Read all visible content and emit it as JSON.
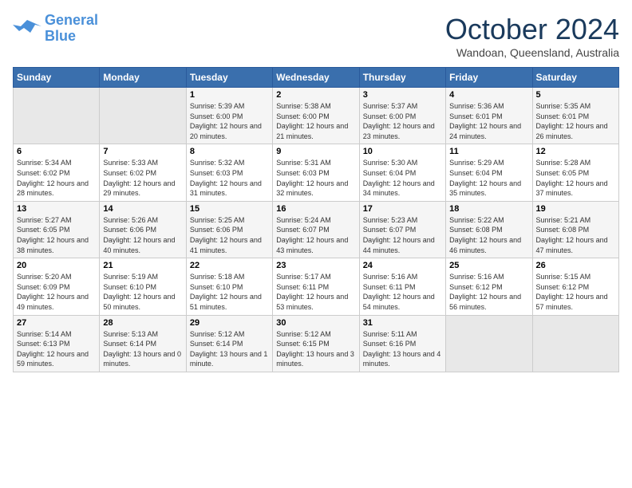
{
  "logo": {
    "line1": "General",
    "line2": "Blue"
  },
  "title": "October 2024",
  "location": "Wandoan, Queensland, Australia",
  "headers": [
    "Sunday",
    "Monday",
    "Tuesday",
    "Wednesday",
    "Thursday",
    "Friday",
    "Saturday"
  ],
  "weeks": [
    [
      {
        "day": "",
        "sunrise": "",
        "sunset": "",
        "daylight": ""
      },
      {
        "day": "",
        "sunrise": "",
        "sunset": "",
        "daylight": ""
      },
      {
        "day": "1",
        "sunrise": "Sunrise: 5:39 AM",
        "sunset": "Sunset: 6:00 PM",
        "daylight": "Daylight: 12 hours and 20 minutes."
      },
      {
        "day": "2",
        "sunrise": "Sunrise: 5:38 AM",
        "sunset": "Sunset: 6:00 PM",
        "daylight": "Daylight: 12 hours and 21 minutes."
      },
      {
        "day": "3",
        "sunrise": "Sunrise: 5:37 AM",
        "sunset": "Sunset: 6:00 PM",
        "daylight": "Daylight: 12 hours and 23 minutes."
      },
      {
        "day": "4",
        "sunrise": "Sunrise: 5:36 AM",
        "sunset": "Sunset: 6:01 PM",
        "daylight": "Daylight: 12 hours and 24 minutes."
      },
      {
        "day": "5",
        "sunrise": "Sunrise: 5:35 AM",
        "sunset": "Sunset: 6:01 PM",
        "daylight": "Daylight: 12 hours and 26 minutes."
      }
    ],
    [
      {
        "day": "6",
        "sunrise": "Sunrise: 5:34 AM",
        "sunset": "Sunset: 6:02 PM",
        "daylight": "Daylight: 12 hours and 28 minutes."
      },
      {
        "day": "7",
        "sunrise": "Sunrise: 5:33 AM",
        "sunset": "Sunset: 6:02 PM",
        "daylight": "Daylight: 12 hours and 29 minutes."
      },
      {
        "day": "8",
        "sunrise": "Sunrise: 5:32 AM",
        "sunset": "Sunset: 6:03 PM",
        "daylight": "Daylight: 12 hours and 31 minutes."
      },
      {
        "day": "9",
        "sunrise": "Sunrise: 5:31 AM",
        "sunset": "Sunset: 6:03 PM",
        "daylight": "Daylight: 12 hours and 32 minutes."
      },
      {
        "day": "10",
        "sunrise": "Sunrise: 5:30 AM",
        "sunset": "Sunset: 6:04 PM",
        "daylight": "Daylight: 12 hours and 34 minutes."
      },
      {
        "day": "11",
        "sunrise": "Sunrise: 5:29 AM",
        "sunset": "Sunset: 6:04 PM",
        "daylight": "Daylight: 12 hours and 35 minutes."
      },
      {
        "day": "12",
        "sunrise": "Sunrise: 5:28 AM",
        "sunset": "Sunset: 6:05 PM",
        "daylight": "Daylight: 12 hours and 37 minutes."
      }
    ],
    [
      {
        "day": "13",
        "sunrise": "Sunrise: 5:27 AM",
        "sunset": "Sunset: 6:05 PM",
        "daylight": "Daylight: 12 hours and 38 minutes."
      },
      {
        "day": "14",
        "sunrise": "Sunrise: 5:26 AM",
        "sunset": "Sunset: 6:06 PM",
        "daylight": "Daylight: 12 hours and 40 minutes."
      },
      {
        "day": "15",
        "sunrise": "Sunrise: 5:25 AM",
        "sunset": "Sunset: 6:06 PM",
        "daylight": "Daylight: 12 hours and 41 minutes."
      },
      {
        "day": "16",
        "sunrise": "Sunrise: 5:24 AM",
        "sunset": "Sunset: 6:07 PM",
        "daylight": "Daylight: 12 hours and 43 minutes."
      },
      {
        "day": "17",
        "sunrise": "Sunrise: 5:23 AM",
        "sunset": "Sunset: 6:07 PM",
        "daylight": "Daylight: 12 hours and 44 minutes."
      },
      {
        "day": "18",
        "sunrise": "Sunrise: 5:22 AM",
        "sunset": "Sunset: 6:08 PM",
        "daylight": "Daylight: 12 hours and 46 minutes."
      },
      {
        "day": "19",
        "sunrise": "Sunrise: 5:21 AM",
        "sunset": "Sunset: 6:08 PM",
        "daylight": "Daylight: 12 hours and 47 minutes."
      }
    ],
    [
      {
        "day": "20",
        "sunrise": "Sunrise: 5:20 AM",
        "sunset": "Sunset: 6:09 PM",
        "daylight": "Daylight: 12 hours and 49 minutes."
      },
      {
        "day": "21",
        "sunrise": "Sunrise: 5:19 AM",
        "sunset": "Sunset: 6:10 PM",
        "daylight": "Daylight: 12 hours and 50 minutes."
      },
      {
        "day": "22",
        "sunrise": "Sunrise: 5:18 AM",
        "sunset": "Sunset: 6:10 PM",
        "daylight": "Daylight: 12 hours and 51 minutes."
      },
      {
        "day": "23",
        "sunrise": "Sunrise: 5:17 AM",
        "sunset": "Sunset: 6:11 PM",
        "daylight": "Daylight: 12 hours and 53 minutes."
      },
      {
        "day": "24",
        "sunrise": "Sunrise: 5:16 AM",
        "sunset": "Sunset: 6:11 PM",
        "daylight": "Daylight: 12 hours and 54 minutes."
      },
      {
        "day": "25",
        "sunrise": "Sunrise: 5:16 AM",
        "sunset": "Sunset: 6:12 PM",
        "daylight": "Daylight: 12 hours and 56 minutes."
      },
      {
        "day": "26",
        "sunrise": "Sunrise: 5:15 AM",
        "sunset": "Sunset: 6:12 PM",
        "daylight": "Daylight: 12 hours and 57 minutes."
      }
    ],
    [
      {
        "day": "27",
        "sunrise": "Sunrise: 5:14 AM",
        "sunset": "Sunset: 6:13 PM",
        "daylight": "Daylight: 12 hours and 59 minutes."
      },
      {
        "day": "28",
        "sunrise": "Sunrise: 5:13 AM",
        "sunset": "Sunset: 6:14 PM",
        "daylight": "Daylight: 13 hours and 0 minutes."
      },
      {
        "day": "29",
        "sunrise": "Sunrise: 5:12 AM",
        "sunset": "Sunset: 6:14 PM",
        "daylight": "Daylight: 13 hours and 1 minute."
      },
      {
        "day": "30",
        "sunrise": "Sunrise: 5:12 AM",
        "sunset": "Sunset: 6:15 PM",
        "daylight": "Daylight: 13 hours and 3 minutes."
      },
      {
        "day": "31",
        "sunrise": "Sunrise: 5:11 AM",
        "sunset": "Sunset: 6:16 PM",
        "daylight": "Daylight: 13 hours and 4 minutes."
      },
      {
        "day": "",
        "sunrise": "",
        "sunset": "",
        "daylight": ""
      },
      {
        "day": "",
        "sunrise": "",
        "sunset": "",
        "daylight": ""
      }
    ]
  ]
}
